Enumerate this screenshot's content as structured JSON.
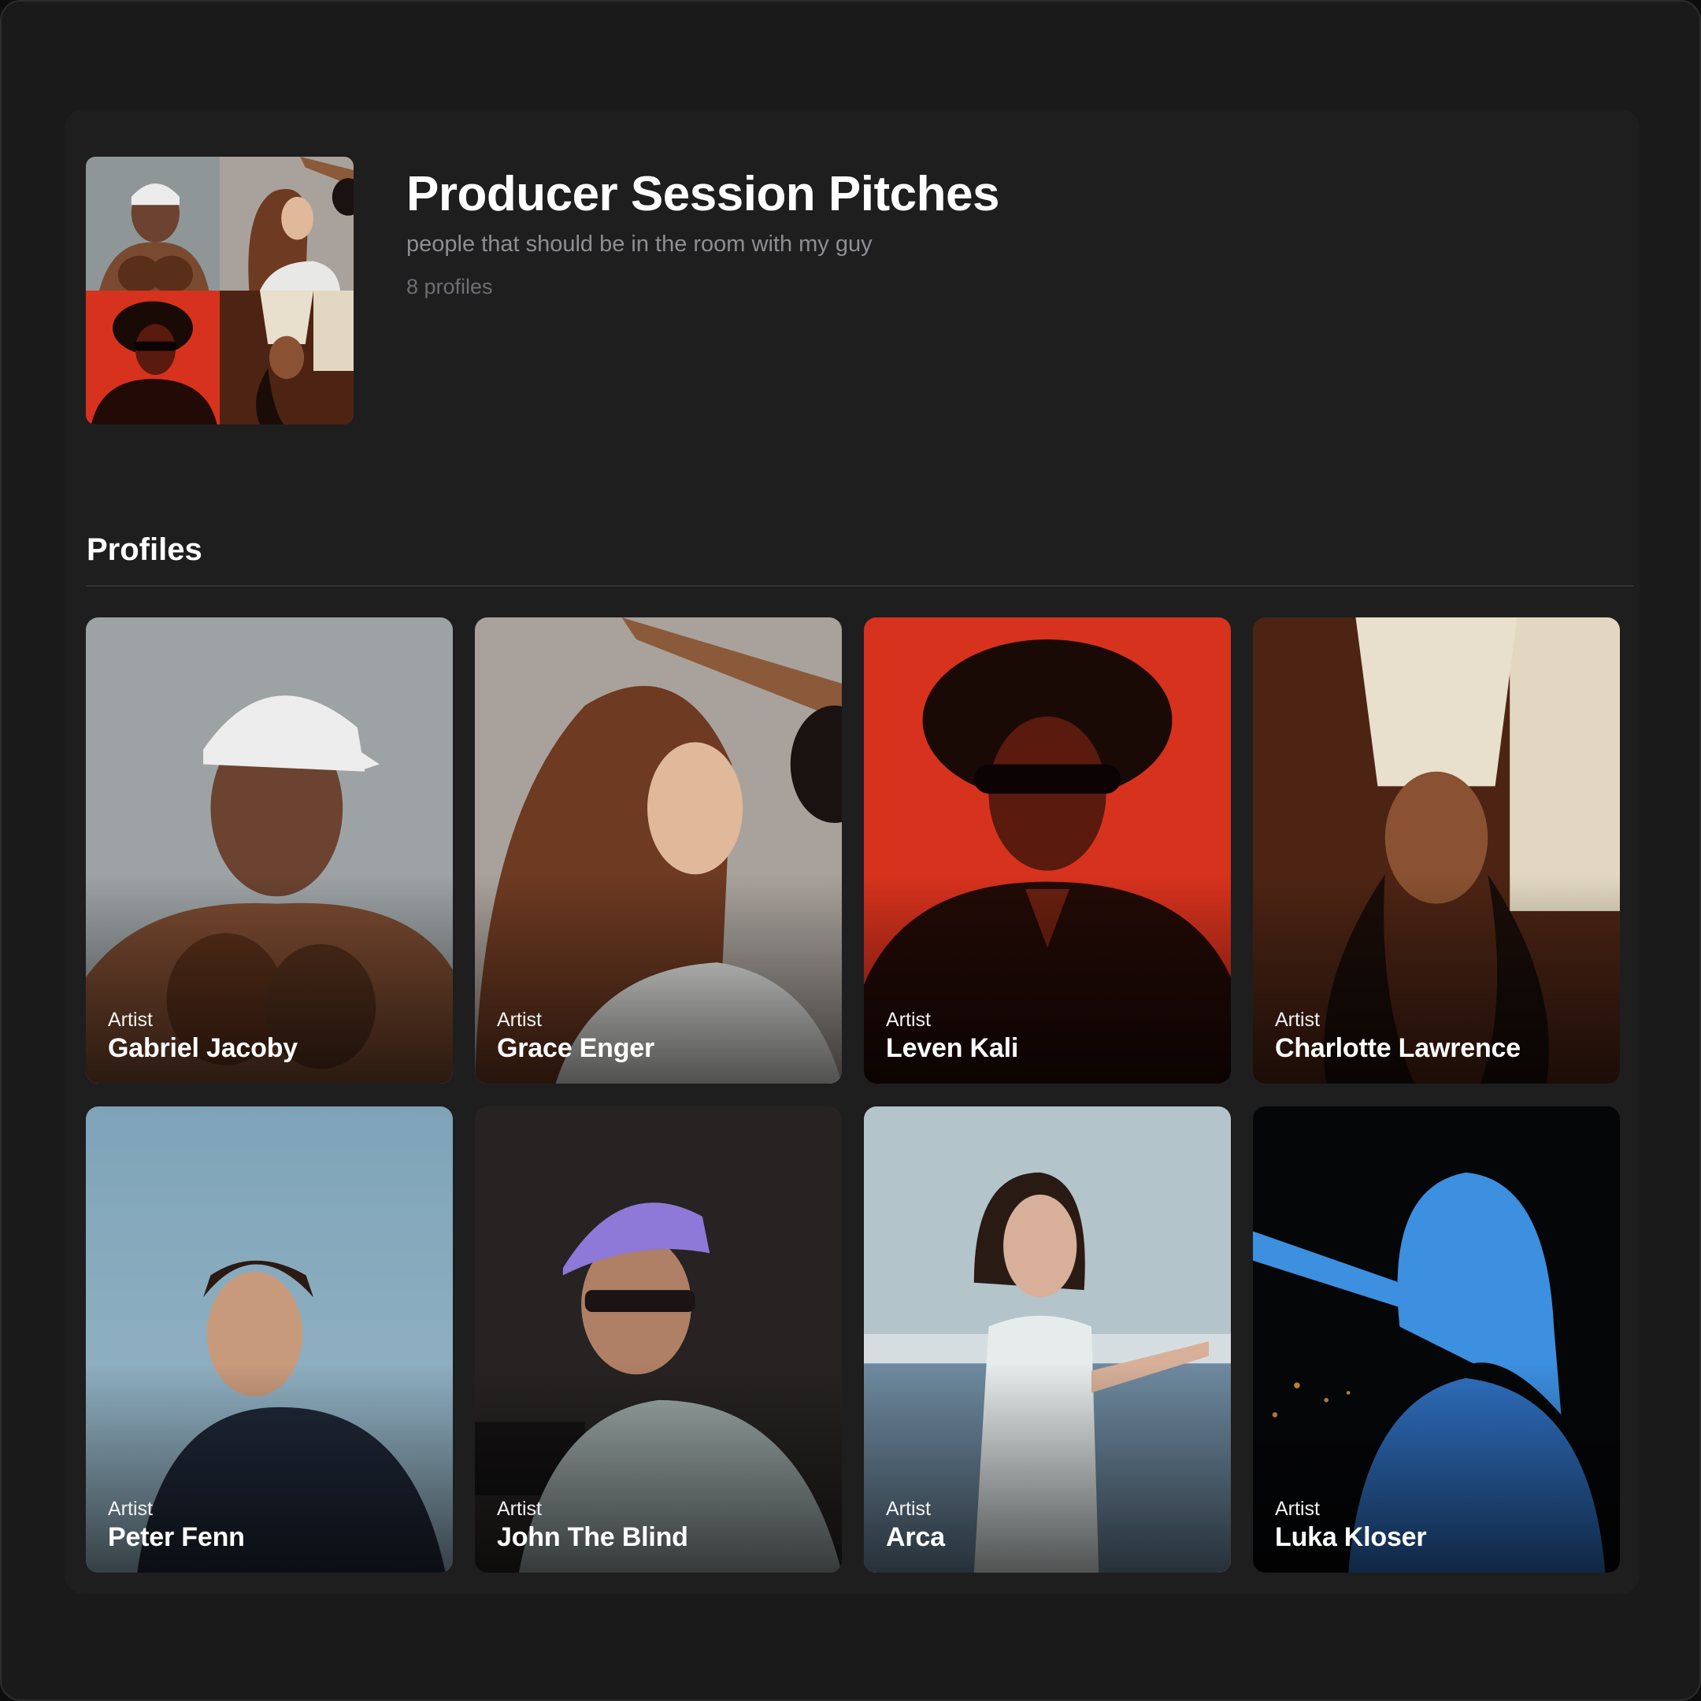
{
  "collection": {
    "title": "Producer Session Pitches",
    "description": "people that should be in the room with my guy",
    "count_label": "8 profiles"
  },
  "section": {
    "title": "Profiles"
  },
  "profiles": [
    {
      "type": "Artist",
      "name": "Gabriel Jacoby",
      "photo_bg": "#8f9698",
      "accent": "#7a4a30"
    },
    {
      "type": "Artist",
      "name": "Grace Enger",
      "photo_bg": "#a9a29c",
      "accent": "#7a4428"
    },
    {
      "type": "Artist",
      "name": "Leven Kali",
      "photo_bg": "#d7321d",
      "accent": "#1c0b08"
    },
    {
      "type": "Artist",
      "name": "Charlotte Lawrence",
      "photo_bg": "#4d2414",
      "accent": "#e8dfcc"
    },
    {
      "type": "Artist",
      "name": "Peter Fenn",
      "photo_bg": "#7ea3b8",
      "accent": "#1f2838"
    },
    {
      "type": "Artist",
      "name": "John The Blind",
      "photo_bg": "#262322",
      "accent": "#9aa7a6"
    },
    {
      "type": "Artist",
      "name": "Arca",
      "photo_bg": "#b3c4ca",
      "accent": "#e6ecec"
    },
    {
      "type": "Artist",
      "name": "Luka Kloser",
      "photo_bg": "#050608",
      "accent": "#3d8fe0"
    }
  ]
}
